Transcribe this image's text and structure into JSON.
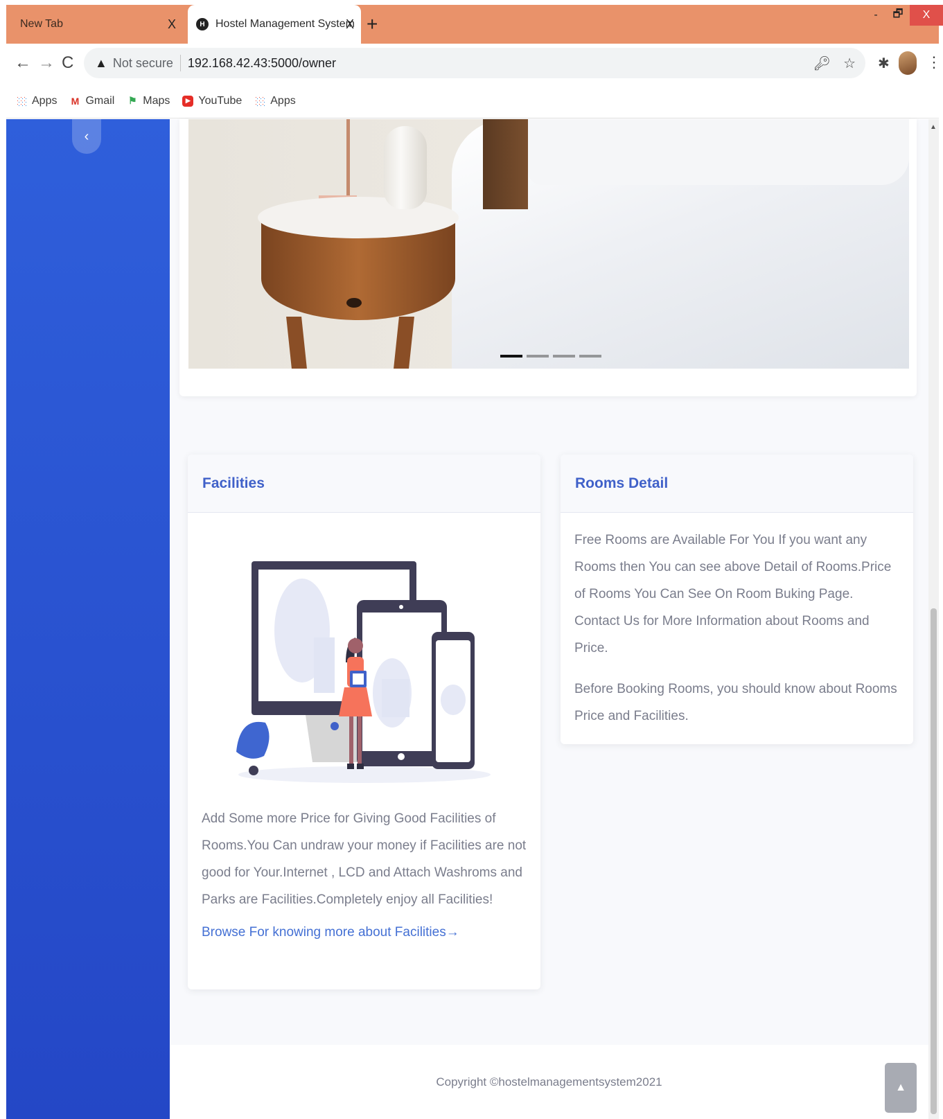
{
  "browser": {
    "tabs": [
      {
        "title": "New Tab",
        "active": false
      },
      {
        "title": "Hostel Management System",
        "active": true
      }
    ],
    "tab_close": "X",
    "favicon_letter": "H",
    "new_tab": "+",
    "window": {
      "minimize": "-",
      "maximize": "🗗",
      "close": "X"
    },
    "nav": {
      "back": "←",
      "forward": "→",
      "reload": "C"
    },
    "omnibox": {
      "warning": "▲",
      "security": "Not secure",
      "url": "192.168.42.43:5000/owner"
    },
    "icons": {
      "key": "key-icon",
      "star": "star-icon",
      "extensions": "puzzle-icon",
      "menu": "kebab-menu-icon"
    },
    "bookmarks": [
      {
        "label": "Apps",
        "icon": "apps-grid-icon"
      },
      {
        "label": "Gmail",
        "icon": "gmail-icon"
      },
      {
        "label": "Maps",
        "icon": "maps-icon"
      },
      {
        "label": "YouTube",
        "icon": "youtube-icon"
      },
      {
        "label": "Apps",
        "icon": "apps-grid-icon"
      }
    ]
  },
  "sidebar": {
    "toggle": "‹"
  },
  "carousel": {
    "slides": 4,
    "active_slide": 1
  },
  "facilities": {
    "title": "Facilities",
    "text": "Add Some more Price for Giving Good Facilities of Rooms.You Can undraw your money if Facilities are not good for Your.Internet , LCD and Attach Washroms and Parks are Facilities.Completely enjoy all Facilities!",
    "link": "Browse For knowing more about Facilities→"
  },
  "rooms": {
    "title": "Rooms Detail",
    "p1": "Free Rooms are Available For You If you want any Rooms then You can see above Detail of Rooms.Price of Rooms You Can See On Room Buking Page. Contact Us for More Information about Rooms and Price.",
    "p2": "Before Booking Rooms, you should know about Rooms Price and Facilities."
  },
  "footer": {
    "copyright": "Copyright ©hostelmanagementsystem2021"
  },
  "scroll_top": "▲",
  "colors": {
    "sidebar": "#2f5fdb",
    "accent": "#4061c9",
    "tabstrip": "#e9926a"
  }
}
